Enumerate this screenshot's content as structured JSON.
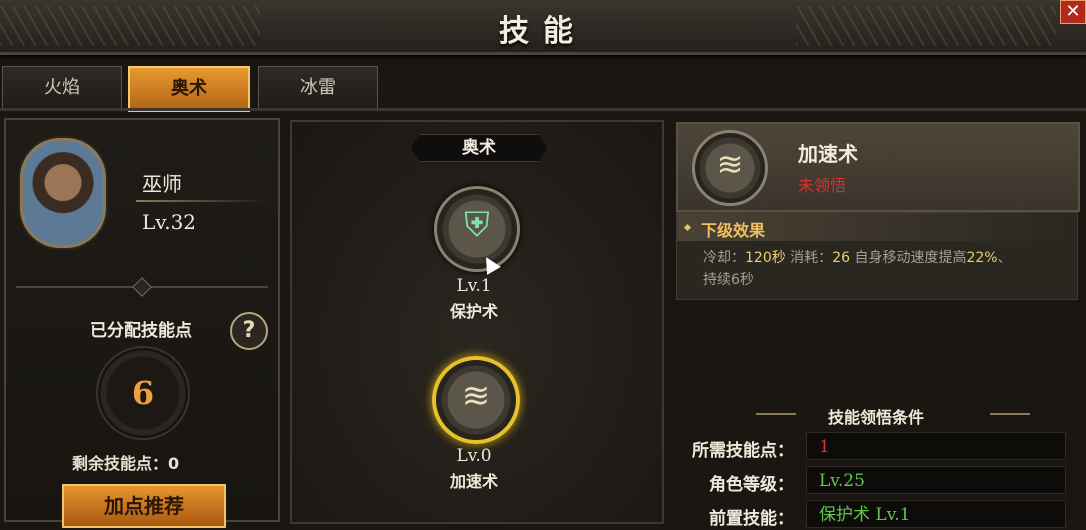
{
  "header": {
    "title": "技能",
    "close_icon": "close-icon"
  },
  "tabs": [
    {
      "label": "火焰",
      "active": false
    },
    {
      "label": "奥术",
      "active": true
    },
    {
      "label": "冰雷",
      "active": false
    }
  ],
  "character": {
    "name": "巫师",
    "level": "Lv.32",
    "allocated_label": "已分配技能点",
    "allocated_value": "6",
    "help_label": "?",
    "remaining_label": "剩余技能点：0",
    "recommend_button": "加点推荐"
  },
  "branch": {
    "title": "奥术",
    "skills": [
      {
        "level": "Lv.1",
        "name": "保护术",
        "icon": "shield-spell-icon"
      },
      {
        "level": "Lv.0",
        "name": "加速术",
        "icon": "haste-icon",
        "selected": true
      }
    ]
  },
  "selected_skill": {
    "name": "加速术",
    "status": "未领悟",
    "effect_title": "下级效果",
    "effect_line1_a": "冷却：",
    "effect_line1_cd": "120秒",
    "effect_line1_b": "  消耗：",
    "effect_line1_cost": "26",
    "effect_line1_c": "  自身移动速度提高",
    "effect_line1_pct": "22%",
    "effect_line1_d": "、",
    "effect_line2": "持续6秒"
  },
  "conditions": {
    "title": "技能领悟条件",
    "rows": [
      {
        "label": "所需技能点：",
        "value": "1",
        "color": "#e0302a"
      },
      {
        "label": "角色等级：",
        "value": "Lv.25",
        "color": "#5fc84a"
      },
      {
        "label": "前置技能：",
        "value": "保护术 Lv.1",
        "color": "#5fc84a"
      }
    ]
  }
}
